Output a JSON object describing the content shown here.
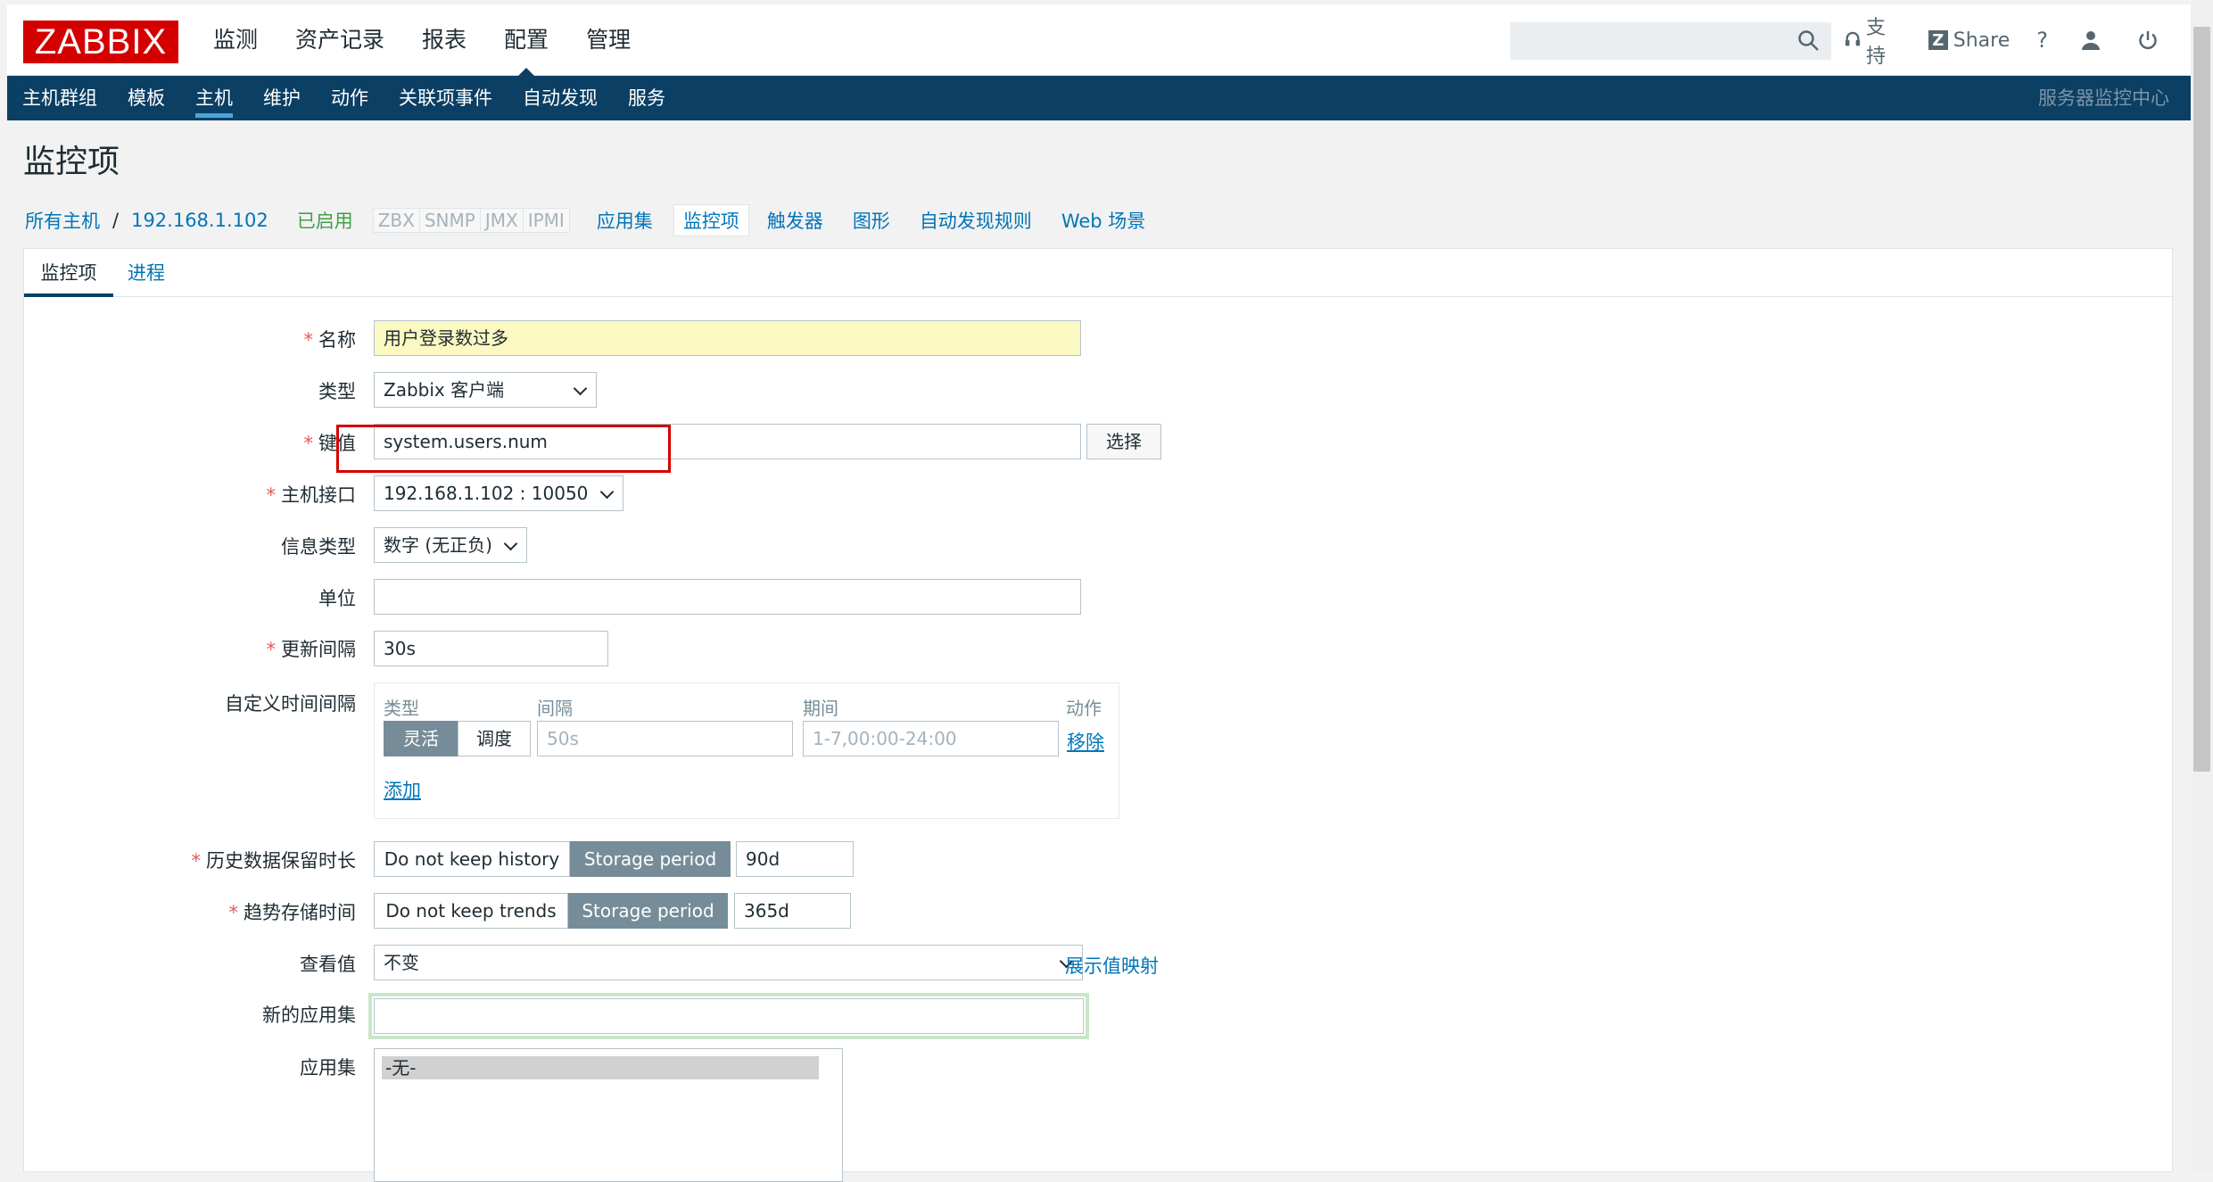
{
  "header": {
    "logo": "ZABBIX",
    "nav": [
      "监测",
      "资产记录",
      "报表",
      "配置",
      "管理"
    ],
    "active_nav": "配置",
    "support": "支持",
    "share": "Share",
    "help": "?"
  },
  "subnav": {
    "items": [
      "主机群组",
      "模板",
      "主机",
      "维护",
      "动作",
      "关联项事件",
      "自动发现",
      "服务"
    ],
    "active": "主机",
    "right_label": "服务器监控中心"
  },
  "page": {
    "title": "监控项"
  },
  "host_nav": {
    "all_hosts": "所有主机",
    "separator": "/",
    "host": "192.168.1.102",
    "status": "已启用",
    "availability": [
      "ZBX",
      "SNMP",
      "JMX",
      "IPMI"
    ],
    "tabs": [
      "应用集",
      "监控项",
      "触发器",
      "图形",
      "自动发现规则",
      "Web 场景"
    ],
    "active_tab": "监控项"
  },
  "form_tabs": [
    "监控项",
    "进程"
  ],
  "form": {
    "name": {
      "label": "名称",
      "value": "用户登录数过多"
    },
    "type": {
      "label": "类型",
      "value": "Zabbix 客户端"
    },
    "key": {
      "label": "键值",
      "value": "system.users.num",
      "select_button": "选择"
    },
    "interface": {
      "label": "主机接口",
      "value": "192.168.1.102 : 10050"
    },
    "info_type": {
      "label": "信息类型",
      "value": "数字 (无正负)"
    },
    "units": {
      "label": "单位",
      "value": ""
    },
    "interval": {
      "label": "更新间隔",
      "value": "30s"
    },
    "custom_intervals": {
      "label": "自定义时间间隔",
      "headers": {
        "type": "类型",
        "interval": "间隔",
        "period": "期间",
        "action": "动作"
      },
      "type_options": [
        "灵活",
        "调度"
      ],
      "type_selected": "灵活",
      "interval_placeholder": "50s",
      "period_placeholder": "1-7,00:00-24:00",
      "remove": "移除",
      "add": "添加"
    },
    "history": {
      "label": "历史数据保留时长",
      "options": [
        "Do not keep history",
        "Storage period"
      ],
      "selected": "Storage period",
      "value": "90d"
    },
    "trends": {
      "label": "趋势存储时间",
      "options": [
        "Do not keep trends",
        "Storage period"
      ],
      "selected": "Storage period",
      "value": "365d"
    },
    "valuemap": {
      "label": "查看值",
      "value": "不变",
      "link": "展示值映射"
    },
    "new_app": {
      "label": "新的应用集",
      "value": ""
    },
    "applications": {
      "label": "应用集",
      "options": [
        "-无-"
      ]
    }
  },
  "colors": {
    "brand_red": "#d40000",
    "nav_bg": "#0b3f64",
    "link": "#0275b8",
    "enabled": "#429e47",
    "segment_on": "#768d99",
    "highlight_box": "#d40000"
  }
}
